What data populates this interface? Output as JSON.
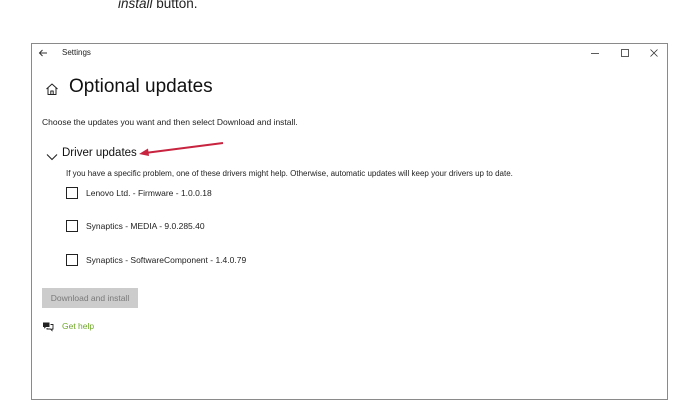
{
  "caption": {
    "line_fragment": "install",
    "line_suffix": " button."
  },
  "window": {
    "title": "Settings"
  },
  "header": {
    "title": "Optional updates"
  },
  "instructions": "Choose the updates you want and then select Download and install.",
  "driver_updates": {
    "title": "Driver updates",
    "description": "If you have a specific problem, one of these drivers might help. Otherwise, automatic updates will keep your drivers up to date.",
    "items": [
      {
        "label": "Lenovo Ltd. - Firmware - 1.0.0.18",
        "checked": false
      },
      {
        "label": "Synaptics - MEDIA - 9.0.285.40",
        "checked": false
      },
      {
        "label": "Synaptics - SoftwareComponent - 1.4.0.79",
        "checked": false
      }
    ]
  },
  "download_button": {
    "label": "Download and install",
    "enabled": false
  },
  "help": {
    "label": "Get help"
  },
  "colors": {
    "accent_link": "#6ea827",
    "annotation_arrow": "#c8233f",
    "disabled_button_bg": "#cccccc"
  }
}
